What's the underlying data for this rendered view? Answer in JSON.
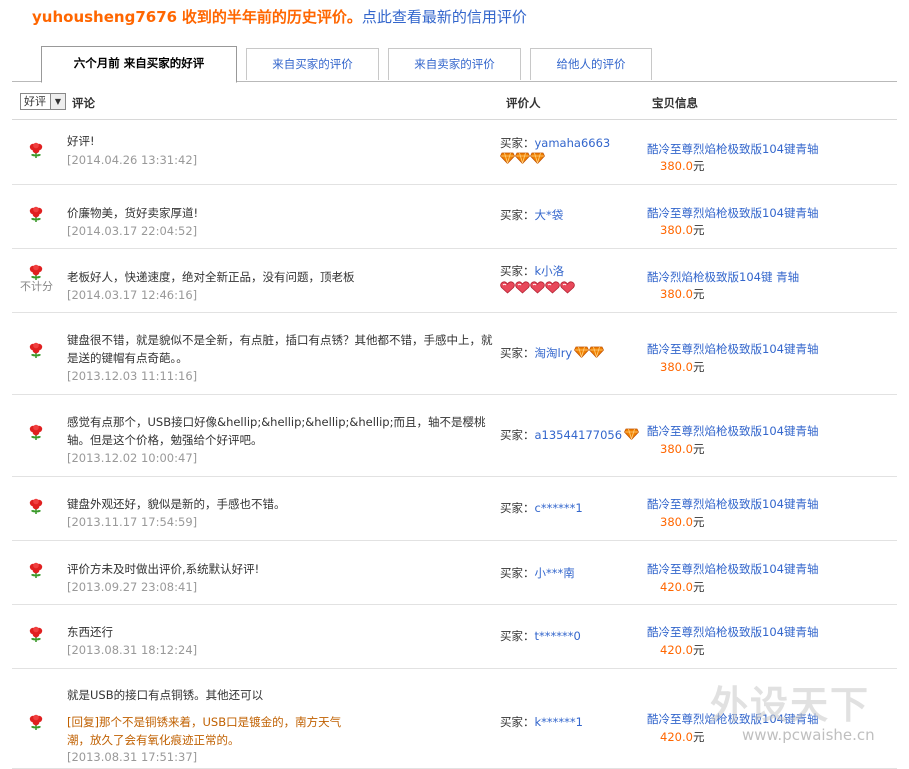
{
  "title": {
    "user": "yuhousheng7676",
    "text": "收到的半年前的历史评价",
    "sep": "。",
    "link": "点此查看最新的信用评价"
  },
  "tabs": [
    {
      "label": "六个月前 来自买家的好评",
      "active": true
    },
    {
      "label": "来自买家的评价",
      "active": false
    },
    {
      "label": "来自卖家的评价",
      "active": false
    },
    {
      "label": "给他人的评价",
      "active": false
    }
  ],
  "header": {
    "filter_value": "好评",
    "comment": "评论",
    "rater": "评价人",
    "item": "宝贝信息"
  },
  "rows": [
    {
      "comment": "好评!",
      "reply": "",
      "date": "[2014.04.26 13:31:42]",
      "no_count": "",
      "rater_role": "买家：",
      "rater_nick": "yamaha6663",
      "badges": "diamond",
      "badge_count": 3,
      "badge_inline": false,
      "item_name": "酷冷至尊烈焰枪极致版104键青轴",
      "price": "380.0",
      "unit": "元"
    },
    {
      "comment": "价廉物美，货好卖家厚道!",
      "reply": "",
      "date": "[2014.03.17 22:04:52]",
      "no_count": "",
      "rater_role": "买家：",
      "rater_nick": "大*袋",
      "badges": "",
      "badge_count": 0,
      "badge_inline": false,
      "item_name": "酷冷至尊烈焰枪极致版104键青轴",
      "price": "380.0",
      "unit": "元"
    },
    {
      "comment": "老板好人，快递速度，绝对全新正品，没有问题，顶老板",
      "reply": "",
      "date": "[2014.03.17 12:46:16]",
      "no_count": "不计分",
      "rater_role": "买家：",
      "rater_nick": "k小洛",
      "badges": "heart",
      "badge_count": 5,
      "badge_inline": false,
      "item_name": "酷冷烈焰枪极致版104键 青轴",
      "price": "380.0",
      "unit": "元"
    },
    {
      "comment": "键盘很不错，就是貌似不是全新，有点脏，插口有点锈？其他都不错，手感中上，就是送的键帽有点奇葩。。",
      "reply": "",
      "date": "[2013.12.03 11:11:16]",
      "no_count": "",
      "rater_role": "买家：",
      "rater_nick": "淘淘lry",
      "badges": "diamond",
      "badge_count": 2,
      "badge_inline": true,
      "item_name": "酷冷至尊烈焰枪极致版104键青轴",
      "price": "380.0",
      "unit": "元"
    },
    {
      "comment": "感觉有点那个，USB接口好像&hellip;&hellip;&hellip;&hellip;而且，轴不是樱桃轴。但是这个价格，勉强给个好评吧。",
      "reply": "",
      "date": "[2013.12.02 10:00:47]",
      "no_count": "",
      "rater_role": "买家：",
      "rater_nick": "a13544177056",
      "badges": "diamond",
      "badge_count": 1,
      "badge_inline": true,
      "item_name": "酷冷至尊烈焰枪极致版104键青轴",
      "price": "380.0",
      "unit": "元"
    },
    {
      "comment": "键盘外观还好，貌似是新的，手感也不错。",
      "reply": "",
      "date": "[2013.11.17 17:54:59]",
      "no_count": "",
      "rater_role": "买家：",
      "rater_nick": "c******1",
      "badges": "",
      "badge_count": 0,
      "badge_inline": false,
      "item_name": "酷冷至尊烈焰枪极致版104键青轴",
      "price": "380.0",
      "unit": "元"
    },
    {
      "comment": "评价方未及时做出评价,系统默认好评!",
      "reply": "",
      "date": "[2013.09.27 23:08:41]",
      "no_count": "",
      "rater_role": "买家：",
      "rater_nick": "小***南",
      "badges": "",
      "badge_count": 0,
      "badge_inline": false,
      "item_name": "酷冷至尊烈焰枪极致版104键青轴",
      "price": "420.0",
      "unit": "元"
    },
    {
      "comment": "东西还行",
      "reply": "",
      "date": "[2013.08.31 18:12:24]",
      "no_count": "",
      "rater_role": "买家：",
      "rater_nick": "t******0",
      "badges": "",
      "badge_count": 0,
      "badge_inline": false,
      "item_name": "酷冷至尊烈焰枪极致版104键青轴",
      "price": "420.0",
      "unit": "元"
    },
    {
      "comment": "就是USB的接口有点铜锈。其他还可以",
      "reply": "[回复]那个不是铜锈来着，USB口是镀金的，南方天气潮，放久了会有氧化痕迹正常的。",
      "date": "[2013.08.31 17:51:37]",
      "no_count": "",
      "rater_role": "买家：",
      "rater_nick": "k******1",
      "badges": "",
      "badge_count": 0,
      "badge_inline": false,
      "item_name": "酷冷至尊烈焰枪极致版104键青轴",
      "price": "420.0",
      "unit": "元"
    }
  ],
  "watermark": {
    "big": "外设天下",
    "small": "www.pcwaishe.cn"
  },
  "colors": {
    "accent": "#ff6600",
    "link": "#3366cc",
    "flower": "#e02020",
    "diamond": "#f08000",
    "heart": "#e8485a"
  }
}
